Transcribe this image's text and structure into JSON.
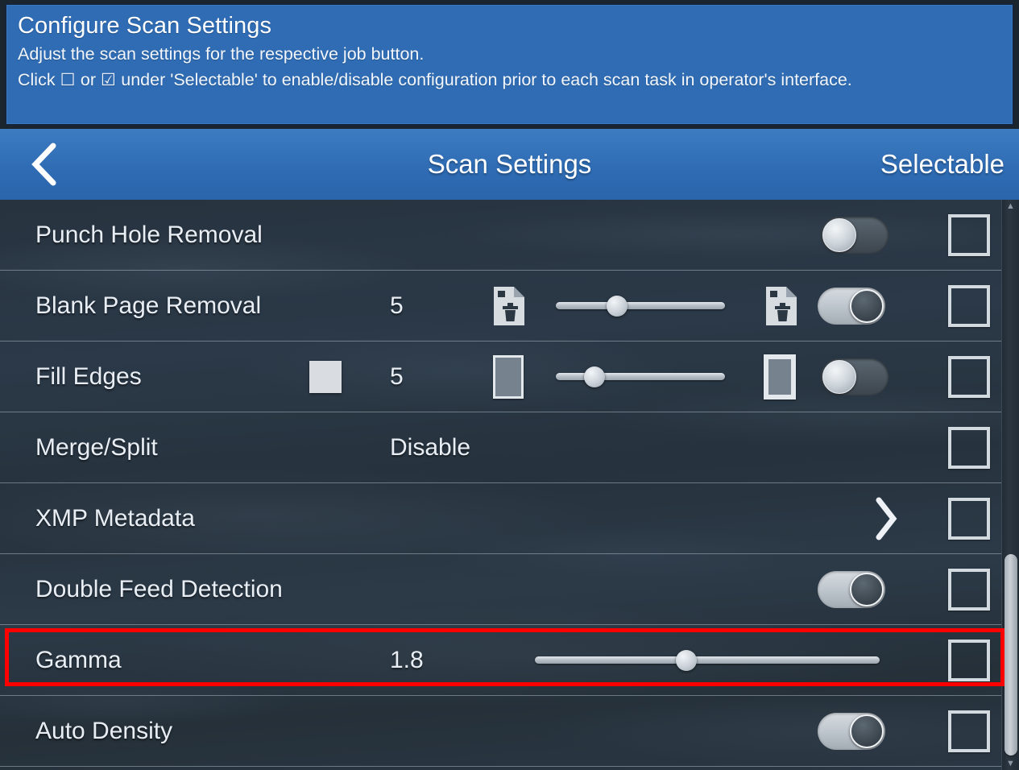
{
  "banner": {
    "title": "Configure Scan Settings",
    "line1": "Adjust the scan settings for the respective job button.",
    "line2_pre": "Click ",
    "unchecked_glyph": "☐",
    "line2_or": " or ",
    "checked_glyph": "☑",
    "line2_post": " under 'Selectable' to enable/disable configuration prior to each scan task in operator's interface."
  },
  "navbar": {
    "back_icon": "chevron-left-icon",
    "title": "Scan Settings",
    "right_label": "Selectable"
  },
  "colors": {
    "accent_blue": "#2f6cb4",
    "list_background": "#2a3845",
    "highlight_red": "#ff0000",
    "text_light": "#e8eef4",
    "swatch_gray": "#d9dde1"
  },
  "rows": [
    {
      "label": "Punch Hole Removal",
      "value": "",
      "toggle": "off",
      "selectable_checked": false
    },
    {
      "label": "Blank Page Removal",
      "value": "5",
      "slider_percent": 36,
      "icon_left": "page-delete-small-icon",
      "icon_right": "page-delete-large-icon",
      "toggle": "on",
      "selectable_checked": false
    },
    {
      "label": "Fill Edges",
      "value": "5",
      "color_swatch": "#d9dde1",
      "slider_percent": 23,
      "icon_left": "page-thin-border-icon",
      "icon_right": "page-thick-border-icon",
      "toggle": "off",
      "selectable_checked": false
    },
    {
      "label": "Merge/Split",
      "value": "Disable",
      "selectable_checked": false
    },
    {
      "label": "XMP Metadata",
      "value": "",
      "chevron": "chevron-right-icon",
      "selectable_checked": false
    },
    {
      "label": "Double Feed Detection",
      "value": "",
      "toggle": "on",
      "selectable_checked": false
    },
    {
      "label": "Gamma",
      "value": "1.8",
      "slider_percent": 44,
      "highlighted": true,
      "selectable_checked": false
    },
    {
      "label": "Auto Density",
      "value": "",
      "toggle": "on",
      "selectable_checked": false
    }
  ],
  "scrollbar": {
    "up_arrow": "▲",
    "down_arrow": "▼",
    "thumb_top_percent": 62,
    "thumb_height_percent": 35
  }
}
